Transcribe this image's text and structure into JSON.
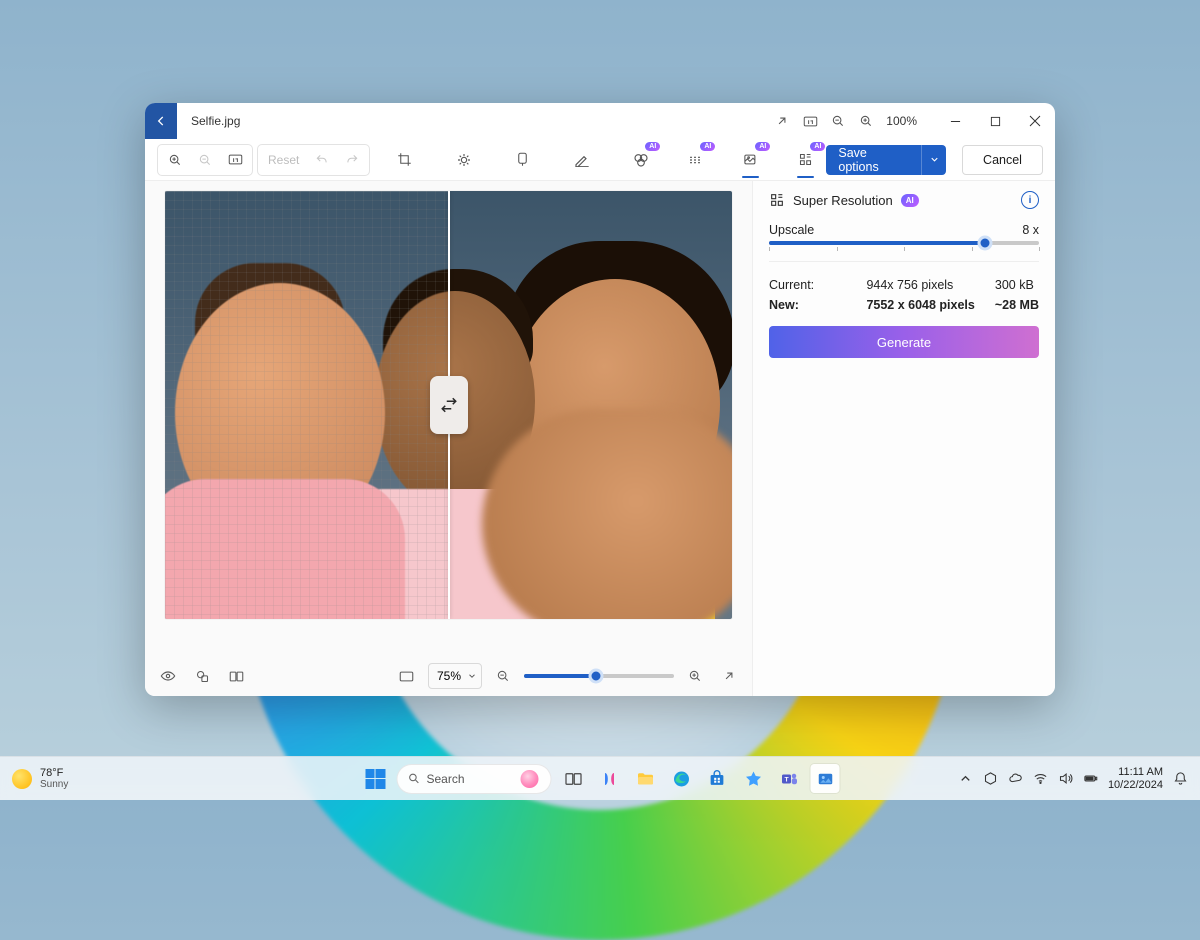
{
  "titlebar": {
    "filename": "Selfie.jpg",
    "zoom_pct": "100%"
  },
  "toolbar": {
    "reset_label": "Reset",
    "save_label": "Save options",
    "cancel_label": "Cancel",
    "ai_badge": "AI"
  },
  "panel": {
    "title": "Super Resolution",
    "ai_badge": "AI",
    "upscale_label": "Upscale",
    "upscale_value": "8 x",
    "upscale_pct": 80,
    "current_label": "Current:",
    "current_dims": "944x 756 pixels",
    "current_size": "300 kB",
    "new_label": "New:",
    "new_dims": "7552 x 6048 pixels",
    "new_size": "~28 MB",
    "generate_label": "Generate"
  },
  "bottombar": {
    "zoom_display": "75%",
    "zoom_slider_fill_pct": 48
  },
  "taskbar": {
    "weather_temp": "78°F",
    "weather_desc": "Sunny",
    "search_placeholder": "Search",
    "time": "11:11 AM",
    "date": "10/22/2024"
  }
}
